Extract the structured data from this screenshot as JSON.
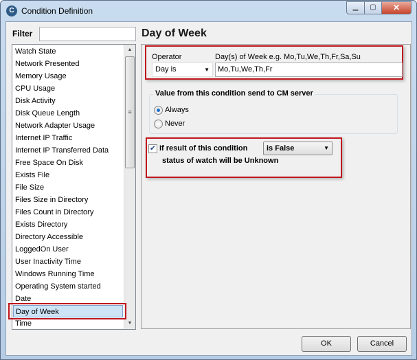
{
  "window": {
    "title": "Condition Definition",
    "app_icon": "C"
  },
  "filter": {
    "label": "Filter",
    "value": ""
  },
  "list": {
    "items": [
      "Watch State",
      "Network Presented",
      "Memory Usage",
      "CPU Usage",
      "Disk Activity",
      "Disk Queue Length",
      "Network Adapter Usage",
      "Internet IP Traffic",
      "Internet IP Transferred Data",
      "Free Space On Disk",
      "Exists File",
      "File Size",
      "Files Size in Directory",
      "Files Count in Directory",
      "Exists Directory",
      "Directory Accessible",
      "LoggedOn User",
      "User Inactivity Time",
      "Windows Running Time",
      "Operating System started",
      "Date",
      "Day of Week",
      "Time"
    ],
    "selected": "Day of Week"
  },
  "main": {
    "heading": "Day of Week",
    "operator_label": "Operator",
    "operator_value": "Day is",
    "days_label": "Day(s) of Week e.g. Mo,Tu,We,Th,Fr,Sa,Su",
    "days_value": "Mo,Tu,We,Th,Fr",
    "group_title": "Value from this condition send to CM server",
    "radio_always": "Always",
    "radio_never": "Never",
    "radio_selected": "Always",
    "checkbox_checked": true,
    "checkbox_label": "If result of this condition",
    "result_value": "is False",
    "status_text": "status of watch will be Unknown"
  },
  "buttons": {
    "ok": "OK",
    "cancel": "Cancel"
  },
  "colors": {
    "highlight": "#c0161d",
    "selection": "#cde4f7"
  }
}
